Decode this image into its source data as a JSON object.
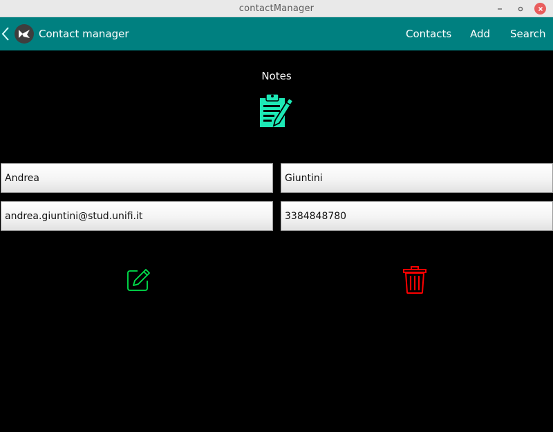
{
  "window": {
    "title": "contactManager"
  },
  "appbar": {
    "title": "Contact manager",
    "menu": {
      "contacts": "Contacts",
      "add": "Add",
      "search": "Search"
    }
  },
  "notes": {
    "label": "Notes",
    "icon": "clipboard-edit-icon"
  },
  "contact": {
    "first_name": "Andrea",
    "last_name": "Giuntini",
    "email": "andrea.giuntini@stud.unifi.it",
    "phone": "3384848780"
  },
  "actions": {
    "edit_icon": "edit-icon",
    "delete_icon": "trash-icon"
  },
  "colors": {
    "appbar": "#008080",
    "notes_icon": "#1de9b6",
    "edit_icon": "#00e64d",
    "delete_icon": "#ff0000",
    "background": "#000000"
  }
}
